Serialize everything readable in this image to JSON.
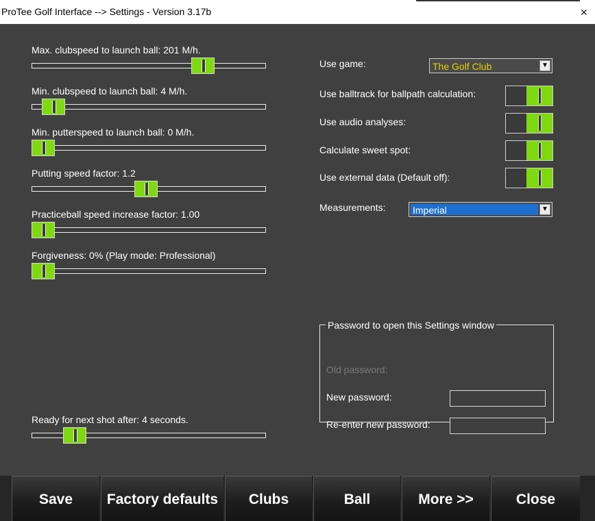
{
  "window": {
    "title": "ProTee Golf Interface --> Settings  - Version 3.17b",
    "close_glyph": "✕"
  },
  "sliders": [
    {
      "label": "Max. clubspeed to launch ball:  201 M/h.",
      "level": 0.76
    },
    {
      "label": "Min. clubspeed to launch ball:  4 M/h.",
      "level": 0.05
    },
    {
      "label": "Min. putterspeed to launch ball:  0 M/h.",
      "level": 0.0
    },
    {
      "label": "Putting speed factor:  1.2",
      "level": 0.49
    },
    {
      "label": "Practiceball speed increase factor:  1.00",
      "level": 0.0
    },
    {
      "label": "Forgiveness:  0% (Play mode: Professional)",
      "level": 0.0
    }
  ],
  "ready_slider": {
    "label": "Ready for next shot after:  4 seconds.",
    "level": 0.15
  },
  "use_game": {
    "label": "Use game:",
    "value": "The Golf Club",
    "value_color": "#e2d400"
  },
  "toggles": [
    {
      "label": "Use balltrack for ballpath calculation:",
      "on": true
    },
    {
      "label": "Use audio analyses:",
      "on": true
    },
    {
      "label": "Calculate sweet spot:",
      "on": true
    },
    {
      "label": "Use external data   (Default off):",
      "on": true
    }
  ],
  "measurements": {
    "label": "Measurements:",
    "value": "Imperial",
    "highlight_color": "#1e6fd2"
  },
  "password": {
    "legend": "Password to open this Settings window",
    "old_label": "Old password:",
    "new_label": "New password:",
    "reenter_label": "Re-enter new password:"
  },
  "buttons": [
    "Save",
    "Factory defaults",
    "Clubs",
    "Ball",
    "More >>",
    "Close"
  ],
  "accent_color": "#7fd90f"
}
